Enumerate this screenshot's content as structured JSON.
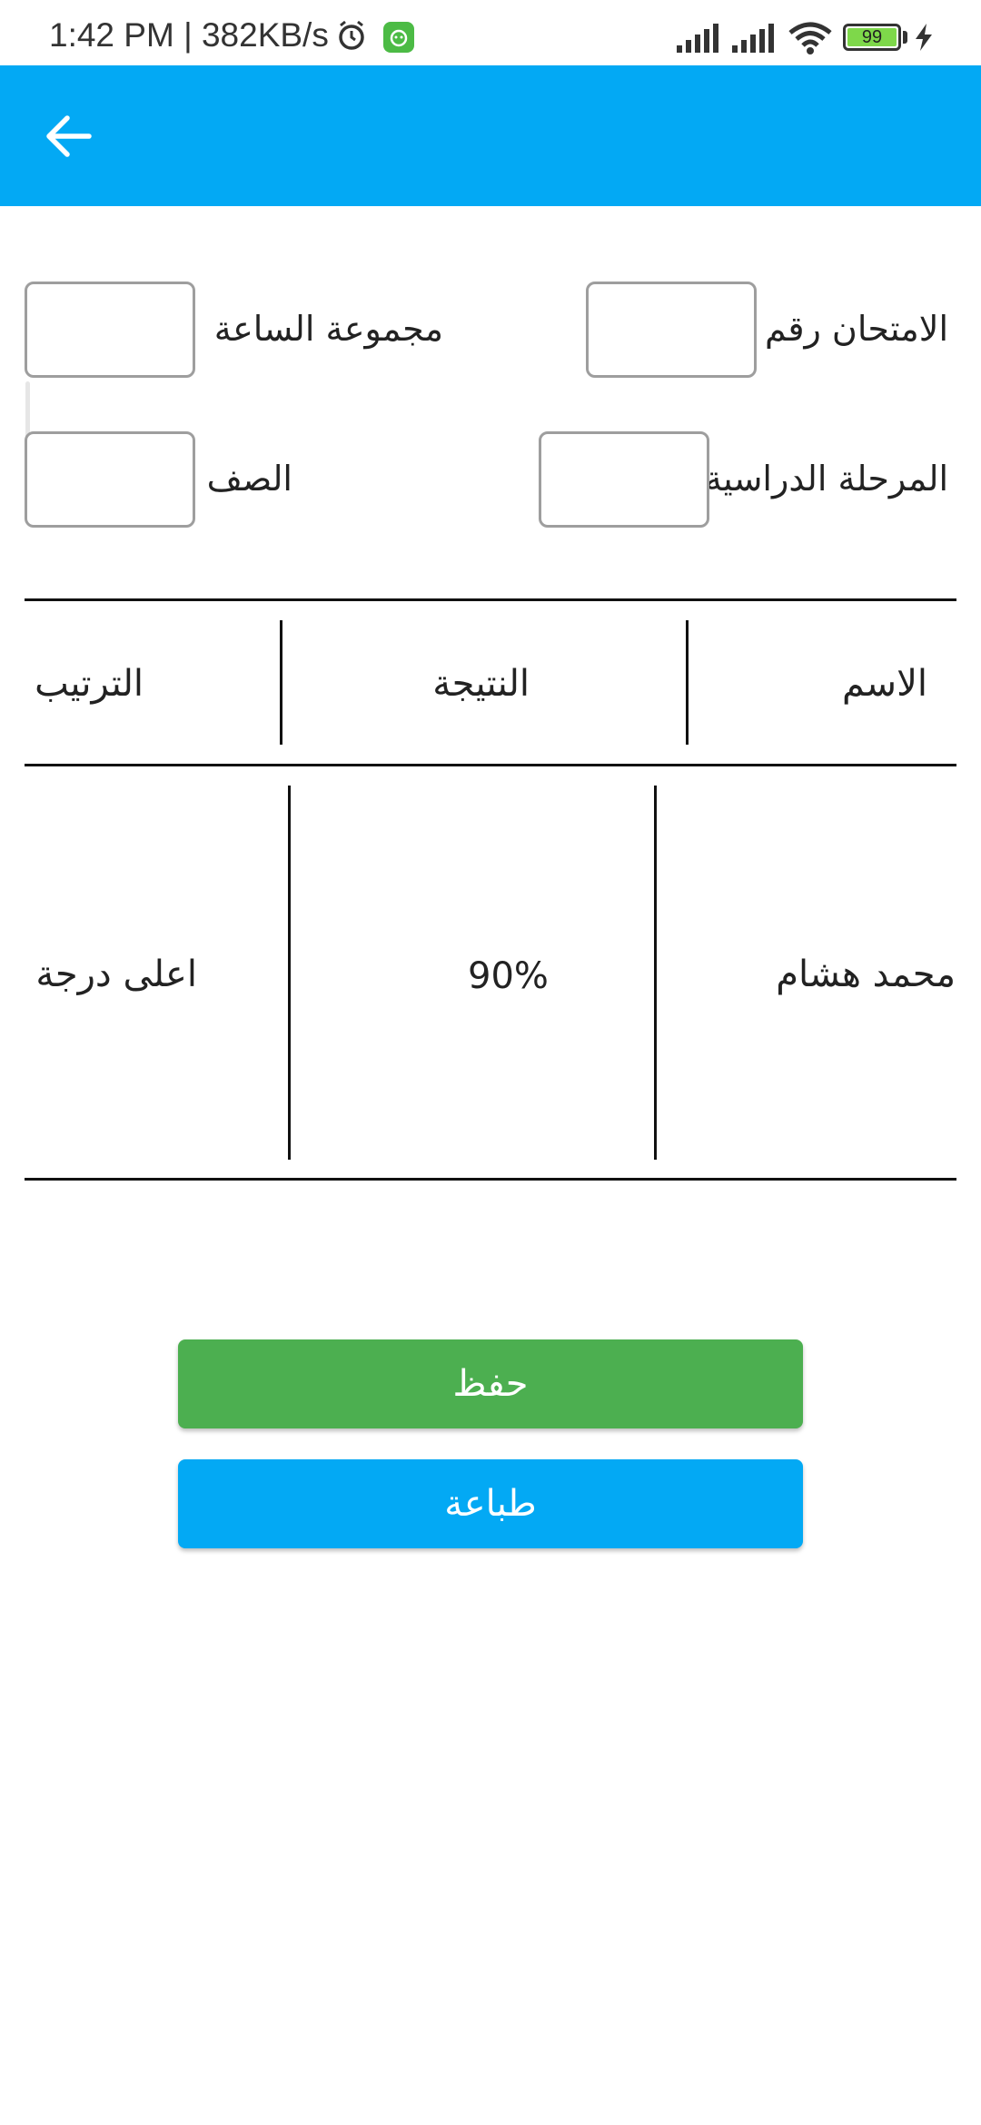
{
  "status_bar": {
    "time": "1:42 PM | 382KB/s",
    "battery": "99",
    "icons": [
      "alarm-icon",
      "app-notification-icon",
      "signal-icon",
      "signal-icon",
      "wifi-icon",
      "battery-icon",
      "charging-icon"
    ]
  },
  "app_bar": {
    "color": "#03a9f4",
    "back_icon": "arrow-back-icon"
  },
  "form": {
    "exam_number_label": "الامتحان رقم",
    "hour_group_label": "مجموعة الساعة",
    "stage_label": "المرحلة الدراسية",
    "class_label": "الصف",
    "exam_number_value": "",
    "hour_group_value": "",
    "stage_value": "",
    "class_value": ""
  },
  "table": {
    "headers": {
      "name": "الاسم",
      "result": "النتيجة",
      "rank": "الترتيب"
    },
    "rows": [
      {
        "name": "محمد هشام",
        "result": "90%",
        "rank": "اعلى درجة"
      }
    ]
  },
  "buttons": {
    "save_label": "حفظ",
    "save_color": "#4caf50",
    "print_label": "طباعة",
    "print_color": "#03a9f4"
  }
}
